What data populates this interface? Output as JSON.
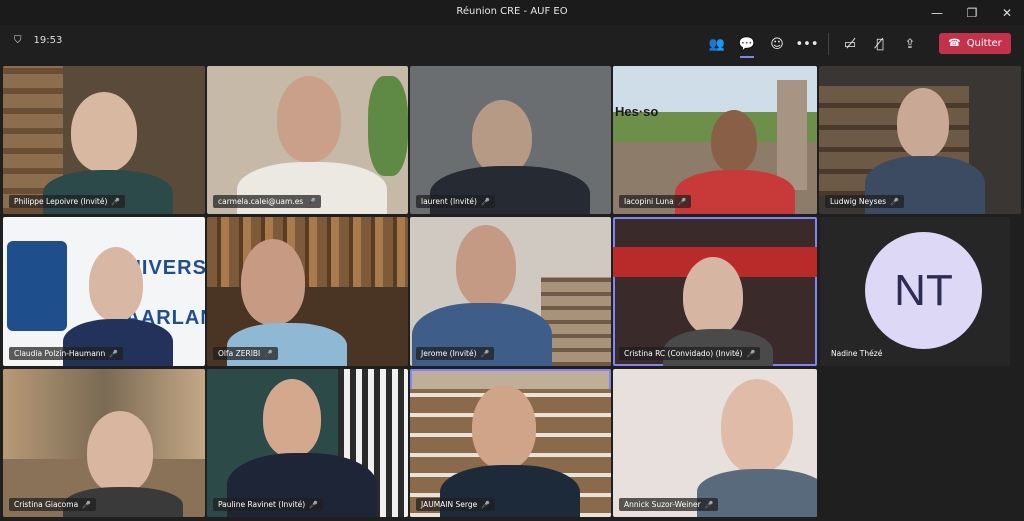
{
  "window": {
    "title": "Réunion CRE - AUF EO"
  },
  "toolbar": {
    "time": "19:53",
    "leave_label": "Quitter"
  },
  "participants": [
    {
      "name": "Philippe Lepoivre (Invité)"
    },
    {
      "name": "carmela.calei@uam.es"
    },
    {
      "name": "laurent (Invité)"
    },
    {
      "name": "Iacopini Luna"
    },
    {
      "name": "Ludwig Neyses"
    },
    {
      "name": "Claudia Polzin-Haumann"
    },
    {
      "name": "Olfa ZERIBI"
    },
    {
      "name": "Jerome (Invité)"
    },
    {
      "name": "Cristina RC (Convidado) (Invité)"
    },
    {
      "name": "Nadine Thézé",
      "initials": "NT"
    },
    {
      "name": "Cristina Giacoma"
    },
    {
      "name": "Pauline Ravinet (Invité)"
    },
    {
      "name": "JAUMAIN Serge"
    },
    {
      "name": "Annick Suzor-Weiner"
    }
  ],
  "backgrounds": {
    "hes": "Hes·so",
    "uni": "UNIVERSITÄ",
    "uni2": "SAARLAND"
  },
  "colors": {
    "accent": "#7f85f5",
    "leave": "#c4314b"
  }
}
